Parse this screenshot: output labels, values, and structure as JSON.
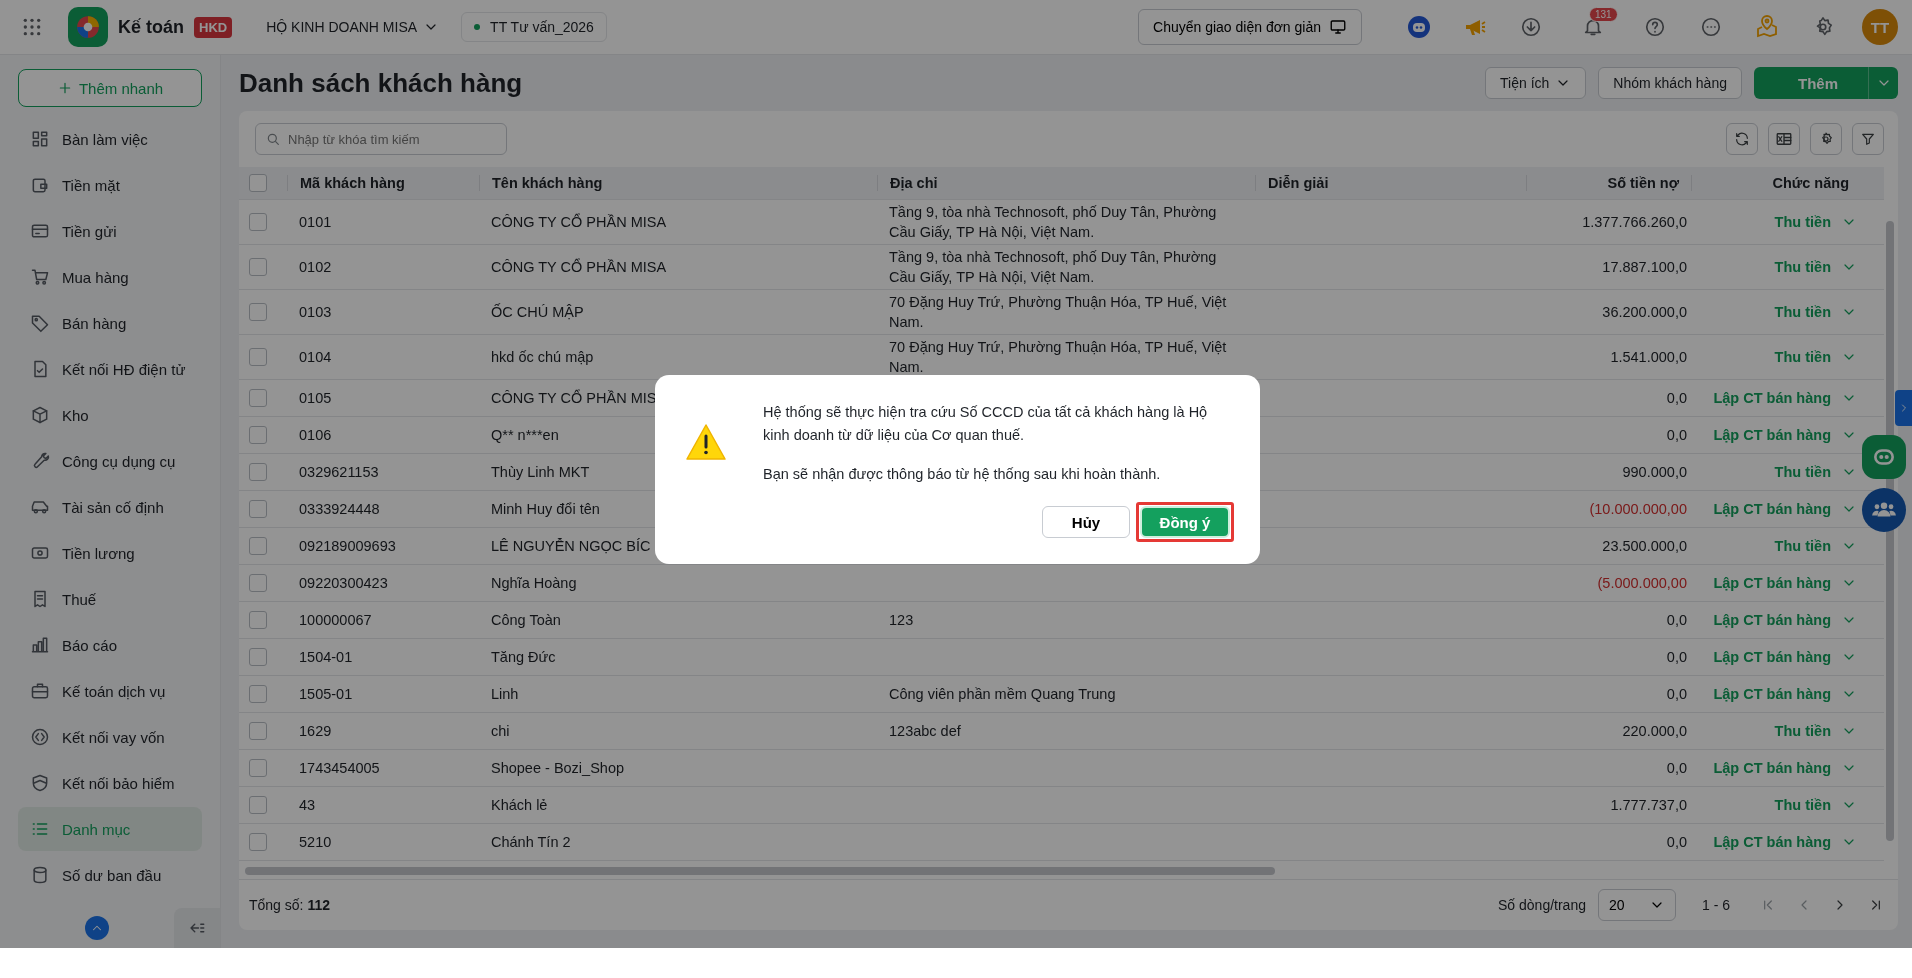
{
  "top_bar": {
    "app_name": "Kế toán",
    "badge": "HKD",
    "org": "HỘ KINH DOANH MISA",
    "workspace": "TT Tư vấn_2026",
    "switch_button": "Chuyển giao diện đơn giản",
    "notification_count": "131",
    "avatar": "TT"
  },
  "sidebar": {
    "quick_add": "Thêm nhanh",
    "items": [
      {
        "label": "Bàn làm việc",
        "selected": false
      },
      {
        "label": "Tiền mặt",
        "selected": false
      },
      {
        "label": "Tiền gửi",
        "selected": false
      },
      {
        "label": "Mua hàng",
        "selected": false
      },
      {
        "label": "Bán hàng",
        "selected": false
      },
      {
        "label": "Kết nối HĐ điện tử",
        "selected": false
      },
      {
        "label": "Kho",
        "selected": false
      },
      {
        "label": "Công cụ dụng cụ",
        "selected": false
      },
      {
        "label": "Tài sản cố định",
        "selected": false
      },
      {
        "label": "Tiền lương",
        "selected": false
      },
      {
        "label": "Thuế",
        "selected": false
      },
      {
        "label": "Báo cáo",
        "selected": false
      },
      {
        "label": "Kế toán dịch vụ",
        "selected": false
      },
      {
        "label": "Kết nối vay vốn",
        "selected": false
      },
      {
        "label": "Kết nối bảo hiểm",
        "selected": false
      },
      {
        "label": "Danh mục",
        "selected": true
      },
      {
        "label": "Số dư ban đầu",
        "selected": false
      }
    ]
  },
  "page": {
    "title": "Danh sách khách hàng",
    "actions": {
      "utilities": "Tiện ích",
      "groups": "Nhóm khách hàng",
      "add": "Thêm"
    },
    "search": {
      "placeholder": "Nhập từ khóa tìm kiếm"
    }
  },
  "table": {
    "select_all_checked": false,
    "columns": [
      "Mã khách hàng",
      "Tên khách hàng",
      "Địa chỉ",
      "Diễn giải",
      "Số tiền nợ",
      "Chức năng"
    ],
    "rows": [
      {
        "checked": false,
        "code": "0101",
        "name": "CÔNG TY CỔ PHẦN MISA",
        "address": "Tầng 9, tòa nhà Technosoft, phố Duy Tân, Phường Cầu Giấy, TP Hà Nội, Việt Nam.",
        "debt": "1.377.766.260,0",
        "negative": false,
        "action": "Thu tiền"
      },
      {
        "checked": false,
        "code": "0102",
        "name": "CÔNG TY CỔ PHẦN MISA",
        "address": "Tầng 9, tòa nhà Technosoft, phố Duy Tân, Phường Cầu Giấy, TP Hà Nội, Việt Nam.",
        "debt": "17.887.100,0",
        "negative": false,
        "action": "Thu tiền"
      },
      {
        "checked": false,
        "code": "0103",
        "name": "ỐC CHÚ MẬP",
        "address": "70 Đặng Huy Trứ, Phường Thuận Hóa, TP Huế, Việt Nam.",
        "debt": "36.200.000,0",
        "negative": false,
        "action": "Thu tiền"
      },
      {
        "checked": false,
        "code": "0104",
        "name": "hkd ốc chú mập",
        "address": "70 Đặng Huy Trứ, Phường Thuận Hóa, TP Huế, Việt Nam.",
        "debt": "1.541.000,0",
        "negative": false,
        "action": "Thu tiền"
      },
      {
        "checked": false,
        "code": "0105",
        "name": "CÔNG TY CỔ PHẦN MIS",
        "debt": "0,0",
        "negative": false,
        "action": "Lập CT bán hàng"
      },
      {
        "checked": false,
        "code": "0106",
        "name": "Q** n***en",
        "debt": "0,0",
        "negative": false,
        "action": "Lập CT bán hàng"
      },
      {
        "checked": false,
        "code": "0329621153",
        "name": "Thùy Linh MKT",
        "debt": "990.000,0",
        "negative": false,
        "action": "Thu tiền"
      },
      {
        "checked": false,
        "code": "0333924448",
        "name": "Minh Huy đổi tên",
        "debt": "(10.000.000,00",
        "negative": true,
        "action": "Lập CT bán hàng"
      },
      {
        "checked": false,
        "code": "092189009693",
        "name": "LÊ NGUYỄN NGỌC BÍC",
        "debt": "23.500.000,0",
        "negative": false,
        "action": "Thu tiền"
      },
      {
        "checked": false,
        "code": "09220300423",
        "name": "Nghĩa Hoàng",
        "debt": "(5.000.000,00",
        "negative": true,
        "action": "Lập CT bán hàng"
      },
      {
        "checked": false,
        "code": "100000067",
        "name": "Công Toàn",
        "address": "123",
        "debt": "0,0",
        "negative": false,
        "action": "Lập CT bán hàng"
      },
      {
        "checked": false,
        "code": "1504-01",
        "name": "Tăng Đức",
        "debt": "0,0",
        "negative": false,
        "action": "Lập CT bán hàng"
      },
      {
        "checked": false,
        "code": "1505-01",
        "name": "Linh",
        "address": "Công viên phần mềm Quang Trung",
        "debt": "0,0",
        "negative": false,
        "action": "Lập CT bán hàng"
      },
      {
        "checked": false,
        "code": "1629",
        "name": "chi",
        "address": "123abc def",
        "debt": "220.000,0",
        "negative": false,
        "action": "Thu tiền"
      },
      {
        "checked": false,
        "code": "1743454005",
        "name": "Shopee - Bozi_Shop",
        "debt": "0,0",
        "negative": false,
        "action": "Lập CT bán hàng"
      },
      {
        "checked": false,
        "code": "43",
        "name": "Khách lẻ",
        "debt": "1.777.737,0",
        "negative": false,
        "action": "Thu tiền"
      },
      {
        "checked": false,
        "code": "5210",
        "name": "Chánh Tín 2",
        "debt": "0,0",
        "negative": false,
        "action": "Lập CT bán hàng"
      }
    ]
  },
  "footer": {
    "total": "Tổng số: **112**",
    "page_size_label": "Số dòng/trang",
    "page_size": "20",
    "range": "1 - 6"
  },
  "dialog": {
    "message": "Hệ thống sẽ thực hiện tra cứu Số CCCD của tất cả khách hàng là Hộ kinh doanh từ dữ liệu của Cơ quan thuế.",
    "note": "Bạn sẽ nhận được thông báo từ hệ thống sau khi hoàn thành.",
    "cancel": "Hủy",
    "confirm": "Đồng ý"
  }
}
